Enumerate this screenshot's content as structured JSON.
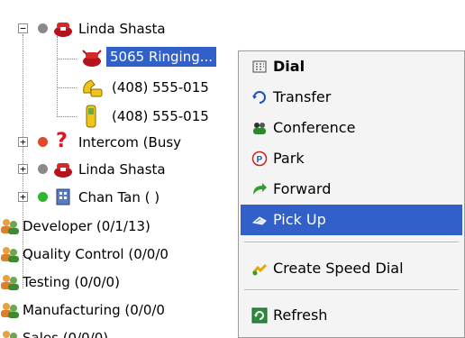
{
  "tree": {
    "items": [
      {
        "label": "Linda Shasta",
        "icon": "phone-red-icon"
      },
      {
        "label": "5065 Ringing...",
        "icon": "phone-ringing-icon"
      },
      {
        "label": "(408) 555-015",
        "icon": "handset-yellow-icon"
      },
      {
        "label": "(408) 555-015",
        "icon": "mobile-phone-icon"
      },
      {
        "label": "Intercom (Busy",
        "icon": "question-mark-icon"
      },
      {
        "label": "Linda Shasta",
        "icon": "phone-red-icon"
      },
      {
        "label": "Chan Tan ( )",
        "icon": "building-icon"
      },
      {
        "label": "Developer  (0/1/13)",
        "icon": "group-icon"
      },
      {
        "label": "Quality Control  (0/0/0",
        "icon": "group-icon"
      },
      {
        "label": "Testing  (0/0/0)",
        "icon": "group-icon"
      },
      {
        "label": "Manufacturing  (0/0/0",
        "icon": "group-icon"
      },
      {
        "label": "Sales  (0/0/0)",
        "icon": "group-icon"
      }
    ]
  },
  "menu": {
    "items": [
      {
        "label": "Dial",
        "icon": "dial-icon",
        "bold": true
      },
      {
        "label": "Transfer",
        "icon": "transfer-icon"
      },
      {
        "label": "Conference",
        "icon": "conference-icon"
      },
      {
        "label": "Park",
        "icon": "park-icon"
      },
      {
        "label": "Forward",
        "icon": "forward-icon"
      },
      {
        "label": "Pick Up",
        "icon": "pickup-icon",
        "highlighted": true
      },
      {
        "label": "Create Speed Dial",
        "icon": "speed-dial-icon"
      },
      {
        "label": "Refresh",
        "icon": "refresh-icon"
      }
    ]
  },
  "colors": {
    "selection": "#3160c8",
    "menu_bg": "#f4f4f4",
    "status_gray": "#8a8a8a",
    "status_red": "#e34a2a",
    "status_green": "#2fb52f"
  }
}
